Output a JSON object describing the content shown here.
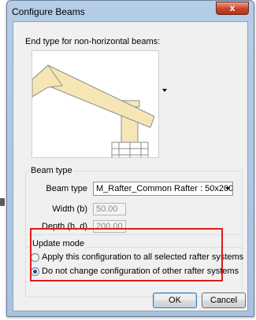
{
  "window": {
    "title": "Configure Beams",
    "close_glyph": "x"
  },
  "end_type": {
    "label": "End type for non-horizontal beams:"
  },
  "beam_type": {
    "group_label": "Beam type",
    "type_label": "Beam type",
    "type_value": "M_Rafter_Common Rafter : 50x200",
    "width_label": "Width (b)",
    "width_value": "50.00",
    "depth_label": "Depth (h, d)",
    "depth_value": "200.00"
  },
  "update_mode": {
    "group_label": "Update mode",
    "options": [
      {
        "label": "Apply this configuration to all selected rafter systems",
        "checked": false
      },
      {
        "label": "Do not change configuration of other rafter systems",
        "checked": true
      }
    ]
  },
  "buttons": {
    "ok": "OK",
    "cancel": "Cancel"
  },
  "colors": {
    "highlight": "#e01b1b",
    "beam_fill": "#f7e6b5",
    "title_bar": "#b5cde6",
    "close": "#c7432a"
  }
}
